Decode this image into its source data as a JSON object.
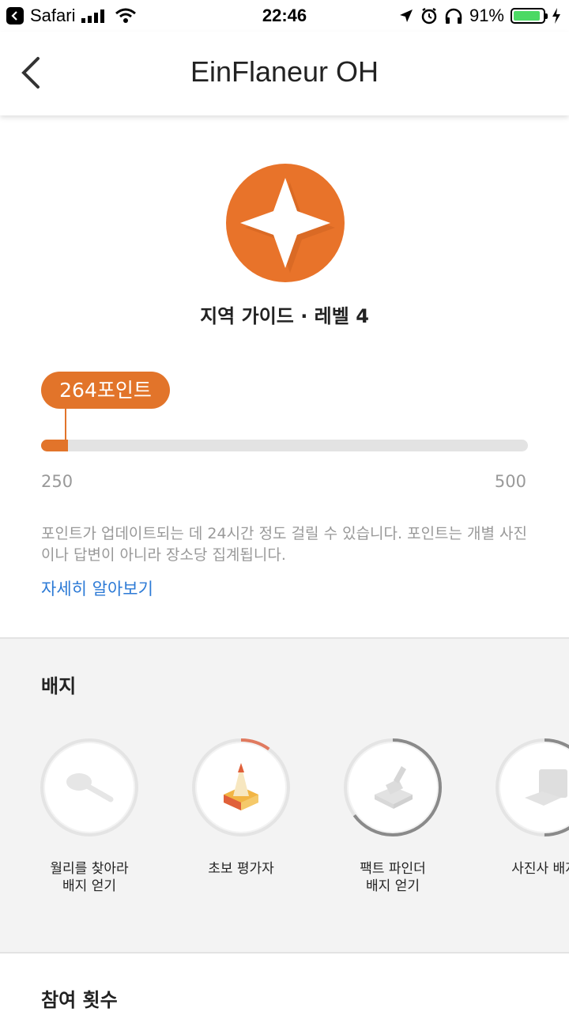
{
  "status_bar": {
    "back_app": "Safari",
    "time": "22:46",
    "battery": "91%",
    "battery_level": 0.91
  },
  "header": {
    "title": "EinFlaneur OH"
  },
  "level": {
    "label": "지역 가이드 · 레벨 4",
    "points_label": "264포인트",
    "points": 264,
    "range_min": "250",
    "range_max": "500",
    "notice": "포인트가 업데이트되는 데 24시간 정도 걸릴 수 있습니다. 포인트는 개별 사진이나 답변이 아니라 장소당 집계됩니다.",
    "learn_more": "자세히 알아보기"
  },
  "badges": {
    "title": "배지",
    "items": [
      {
        "label_1": "월리를 찾아라",
        "label_2": "배지 얻기",
        "icon": "magnifier-icon",
        "progress": 0
      },
      {
        "label_1": "초보 평가자",
        "label_2": "",
        "icon": "pencil-icon",
        "progress": 0.1
      },
      {
        "label_1": "팩트 파인더",
        "label_2": "배지 얻기",
        "icon": "stamp-icon",
        "progress": 0.65
      },
      {
        "label_1": "사진사 배지",
        "label_2": "",
        "icon": "camera-icon",
        "progress": 0.5
      }
    ]
  },
  "participation": {
    "title": "참여 횟수"
  },
  "colors": {
    "accent": "#e2742a",
    "link": "#2c7ad6",
    "muted": "#999999"
  }
}
